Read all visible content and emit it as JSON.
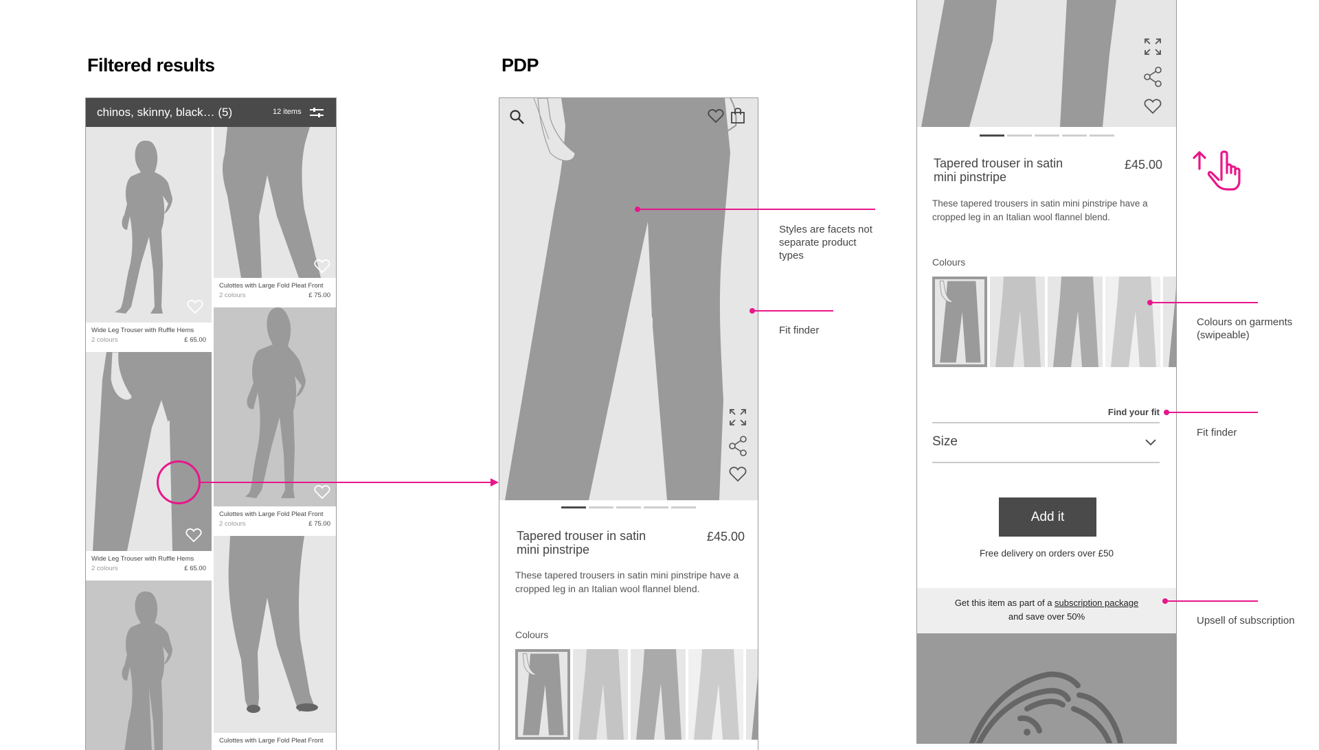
{
  "sections": {
    "filtered_results_title": "Filtered results",
    "pdp_title": "PDP"
  },
  "filtered_results": {
    "query": "chinos, skinny, black… (5)",
    "item_count": "12 items",
    "filter_icon": "sliders-icon",
    "products": [
      {
        "name": "Wide Leg Trouser with Ruffle Hems",
        "colours": "2 colours",
        "price": "£ 65.00"
      },
      {
        "name": "Culottes with Large Fold Pleat Front",
        "colours": "2 colours",
        "price": "£ 75.00"
      },
      {
        "name": "Wide Leg Trouser with Ruffle Hems",
        "colours": "2 colours",
        "price": "£ 65.00"
      },
      {
        "name": "Culottes with Large Fold Pleat Front",
        "colours": "2 colours",
        "price": "£ 75.00"
      },
      {
        "name": "Culottes with Large Fold Pleat Front",
        "colours": "",
        "price": ""
      }
    ]
  },
  "pdp": {
    "icons": [
      "search-icon",
      "heart-icon",
      "bag-icon",
      "expand-icon",
      "share-icon",
      "heart-icon"
    ],
    "carousel": {
      "total": 5,
      "active": 1
    },
    "title": "Tapered trouser in satin mini pinstripe",
    "title_line1": "Tapered trouser in satin",
    "title_line2": "mini pinstripe",
    "price": "£45.00",
    "description_line1": "These tapered trousers in satin mini pinstripe have a",
    "description_line2": "cropped leg in an Italian wool flannel blend.",
    "colours_label": "Colours",
    "swatch_count": 5,
    "selected_swatch": 1
  },
  "pdp_scrolled": {
    "carousel": {
      "total": 5,
      "active": 1
    },
    "title_line1": "Tapered trouser in satin",
    "title_line2": "mini pinstripe",
    "price": "£45.00",
    "description_line1": "These tapered trousers in satin mini pinstripe have a",
    "description_line2": "cropped leg in an Italian wool flannel blend.",
    "colours_label": "Colours",
    "find_fit": "Find your fit",
    "size_label": "Size",
    "add_button": "Add it",
    "delivery": "Free delivery on orders over £50",
    "upsell_prefix": "Get this item as part of a ",
    "upsell_link": "subscription package",
    "upsell_suffix": "and save over 50%",
    "scroll_gesture_icon": "swipe-up-hand-icon"
  },
  "annotations": {
    "styles_facets": [
      "Styles are facets not",
      "separate product",
      "types"
    ],
    "fit_finder_mid": "Fit finder",
    "colours_on_garments": [
      "Colours on garments",
      "(swipeable)"
    ],
    "fit_finder_right": "Fit finder",
    "upsell": "Upsell of subscription"
  },
  "colors": {
    "accent": "#e8168a",
    "header_dark": "#4a4a4a",
    "placeholder_light": "#e6e6e6",
    "silhouette": "#9a9a9a"
  }
}
